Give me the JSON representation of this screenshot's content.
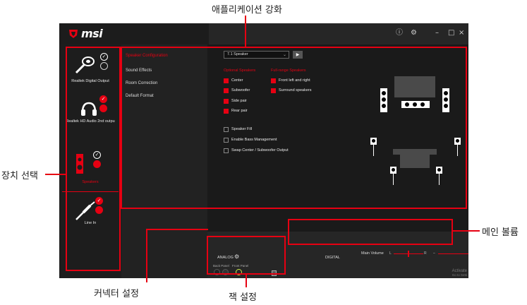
{
  "callouts": {
    "enhancement": "애플리케이션 강화",
    "device_select": "장치 선택",
    "main_volume": "메인 볼륨",
    "connector_settings": "커넥터 설정",
    "jack_settings": "잭 설정"
  },
  "app": {
    "logo": "msi",
    "top_icons": [
      "ⓘ",
      "⚙",
      "–",
      "□",
      "×"
    ]
  },
  "devices": [
    {
      "label": "Realtek Digital Output",
      "icon": "digital-output-icon",
      "selected": false
    },
    {
      "label": "Realtek HD Audio 2nd outpu",
      "icon": "headphones-icon",
      "selected": false
    },
    {
      "label": "Speakers",
      "icon": "speakers-icon",
      "selected": true
    },
    {
      "label": "Line In",
      "icon": "line-in-icon",
      "selected": false
    }
  ],
  "tabs": [
    {
      "label": "Speaker Configuration",
      "active": true
    },
    {
      "label": "Sound Effects",
      "active": false
    },
    {
      "label": "Room Correction",
      "active": false
    },
    {
      "label": "Default Format",
      "active": false
    }
  ],
  "speaker_config": {
    "selected": "7.1 Speaker",
    "optional_title": "Optional Speakers",
    "optional": [
      "Center",
      "Subwoofer",
      "Side pair",
      "Rear pair"
    ],
    "fullrange_title": "Full-range Speakers",
    "fullrange": [
      "Front left and right",
      "Surround speakers"
    ],
    "extra": [
      "Speaker Fill",
      "Enable Bass Management",
      "Swap Center / Subwoofer Output"
    ]
  },
  "connector": {
    "analog": "ANALOG",
    "digital": "DIGITAL",
    "back_panel": "Back Panel",
    "front_panel": "Front Panel"
  },
  "volume": {
    "label": "Main Volume",
    "left": "L",
    "right": "R",
    "minus": "–",
    "plus": "+",
    "balance": 0.5,
    "level": 0.72
  },
  "watermark": {
    "line1": "Activate",
    "line2": "Go to Setti"
  },
  "colors": {
    "accent": "#e60012",
    "background": "#2a2a2a"
  }
}
